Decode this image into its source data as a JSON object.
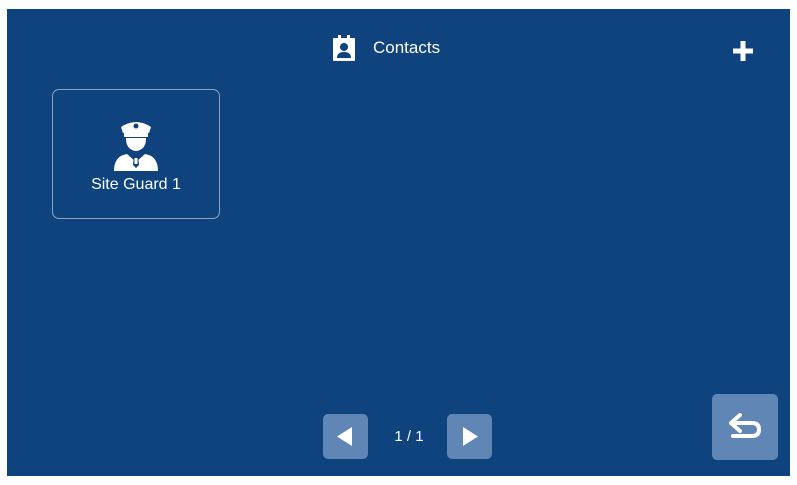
{
  "header": {
    "title": "Contacts",
    "title_icon": "contact-book-icon",
    "add_icon": "plus-icon"
  },
  "contacts": [
    {
      "name": "Site Guard 1",
      "icon": "security-guard-icon"
    }
  ],
  "pagination": {
    "prev_icon": "triangle-left-icon",
    "indicator": "1 / 1",
    "next_icon": "triangle-right-icon"
  },
  "footer": {
    "back_icon": "return-arrow-icon"
  },
  "colors": {
    "background": "#0f437d",
    "button": "#5f86b5",
    "card_border": "#8aa3c4",
    "text": "#ffffff"
  }
}
